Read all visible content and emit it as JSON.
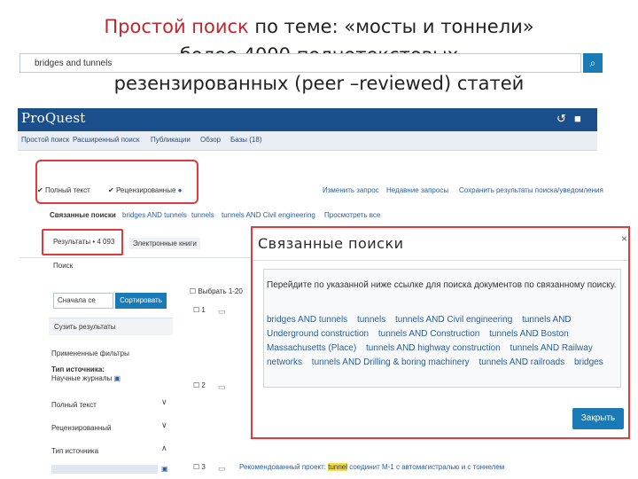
{
  "slide": {
    "title_part1": "Простой поиск",
    "title_part2": " по теме: «мосты и тоннели»",
    "title_line2": "более 4000 полнотекстовых",
    "title_line3": "резензированных   (peer –reviewed) статей"
  },
  "app": {
    "logo": "ProQuest",
    "history_icon": "history-icon",
    "folder_icon": "folder-icon"
  },
  "nav": {
    "items": [
      "Простой поиск",
      "Расширенный поиск",
      "Публикации",
      "Обзор",
      "Базы (18)"
    ]
  },
  "search": {
    "query": "bridges and tunnels",
    "full_text": "Полный текст",
    "peer_reviewed": "Рецензированные",
    "edit": "Изменить запрос",
    "recent": "Недавние запросы",
    "save": "Сохранить результаты поиска/уведомления",
    "related_label": "Связанные поиски",
    "related_links": [
      "bridges AND tunnels",
      "tunnels",
      "tunnels AND Civil engineering"
    ],
    "more": "Просмотреть все"
  },
  "tabs": {
    "results": "Результаты • 4 093",
    "ebooks": "Электронные книги"
  },
  "left": {
    "search_label": "Поиск",
    "sort_select": "Сначала се",
    "sort_button": "Сортировать",
    "summary": "Сузить результаты",
    "applied": "Примененные фильтры",
    "source_type": "Тип источника:",
    "scholarly": "Научные журналы",
    "fulltext_sec": "Полный текст",
    "peer_sec": "Рецензированный",
    "type_sec": "Тип источника"
  },
  "results": {
    "select_all": "Выбрать 1-20",
    "row1_num": "1",
    "row2_num": "2",
    "row3_num": "3",
    "row3_pre": "Рекомендованный проект: ",
    "row3_hl": "tunnel",
    "row3_post": " соединит M-1 с автомагистралью и с тоннелем"
  },
  "modal": {
    "title": "Связанные поиски",
    "instruction": "Перейдите по указанной ниже ссылке для поиска документов по связанному поиску.",
    "links": [
      "bridges AND tunnels",
      "tunnels",
      "tunnels AND Civil engineering",
      "tunnels AND Underground construction",
      "tunnels AND Construction",
      "tunnels AND Boston Massachusetts (Place)",
      "tunnels AND highway construction",
      "tunnels AND Railway networks",
      "tunnels AND Drilling & boring machinery",
      "tunnels AND railroads",
      "bridges"
    ],
    "close": "Закрыть"
  },
  "colors": {
    "brand": "#1a4f8b",
    "accent": "#1a7ab5",
    "highlight_red": "#e03a3a"
  }
}
